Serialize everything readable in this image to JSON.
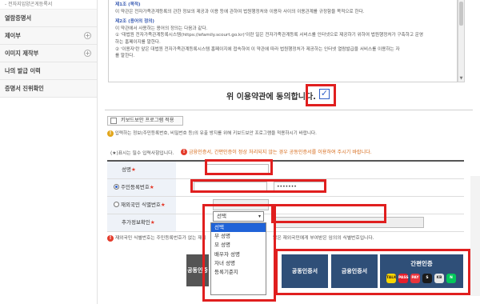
{
  "sidebar": {
    "sub_item": "- 전자지입양곤게등록서",
    "items": [
      {
        "label": "열람증명서",
        "has_plus": false
      },
      {
        "label": "제이부",
        "has_plus": true
      },
      {
        "label": "이미지 제작부",
        "has_plus": true
      },
      {
        "label": "나의 발급 이력",
        "has_plus": false
      },
      {
        "label": "증명서 진위확인",
        "has_plus": false
      }
    ]
  },
  "terms": {
    "lines": [
      {
        "text": "제1조 (목적)",
        "article": true
      },
      {
        "text": "이 약관은 전자가족관계등록의 관한 정보의 제공과 이용 등에 관하여 법원행정처와 이용자 사이의 이용관계를 규정함을 목적으로 한다.",
        "article": false
      },
      {
        "text": "",
        "article": false
      },
      {
        "text": "제2조 (용어의 정의)",
        "article": true
      },
      {
        "text": "이 약관에서 사용하는 용어의 정의는 다음과 같다.",
        "article": false
      },
      {
        "text": "① '대법원 전자가족관계등록시스템(https://efamily.scourt.go.kr)'이란 일은 전자가족관계등록 서비스를 인터넷으로 제공하기 위하여 법원행정처가 구축하고 운영",
        "article": false
      },
      {
        "text": "    하는 홈페이지를 말한다.",
        "article": false
      },
      {
        "text": "② '이용자'란 앞은 대법원 전자가족관계등록시스템 홈페이지에 접속하여 이 약관에 따라 법원행정처가 제공하는 인터넷 열람발급을 서비스를 이용하는 자",
        "article": false
      },
      {
        "text": "    를 말한다.",
        "article": false
      }
    ]
  },
  "agree": {
    "label": "위 이용약관에 동의합니다.",
    "checked": true
  },
  "keyboard": {
    "label": "키보드보안 프로그램 적용",
    "note": "입력하는 정보(주민등록번호, 비밀번호 등)의 유출 방지를 위해 키보드보안 프로그램을 적용하시기 바랍니다."
  },
  "required_note": "(★)표시는 필수 입력사항입니다.",
  "cert_note": "금융인증서, 간편인증이 정상 처리되지 않는 경우 공동인증서를 이용하여 주시기 바랍니다.",
  "form": {
    "name": {
      "label": "성명",
      "value": ""
    },
    "rrn": {
      "label": "주민등록번호",
      "front": "",
      "back": "•••••••"
    },
    "foreign": {
      "label": "재외국민 식별번호",
      "value": ""
    },
    "extra": {
      "label": "추가정보확인",
      "select_value": "선택",
      "select_caret": "▾",
      "input_value": ""
    }
  },
  "dropdown_options": [
    "선택",
    "부 성명",
    "모 성명",
    "배우자 성명",
    "자녀 성명",
    "등록기준지"
  ],
  "id_note": {
    "left": "재외국민 식별번호는 주민등록번호가 없는 재외",
    "right": "않은 재외국민에게 부여받은 임의의 식별번호입니다."
  },
  "buttons": {
    "faded_label": "공동인증",
    "joint_cert": "공동인증서",
    "financial_cert": "금융인증서",
    "simple_cert": "간편인증"
  },
  "brands": [
    {
      "name": "kakao",
      "text": "TALK",
      "bg": "#f7d600",
      "fg": "#3a1d1d"
    },
    {
      "name": "pass",
      "text": "PASS",
      "bg": "#e61e2b",
      "fg": "#ffffff"
    },
    {
      "name": "payco",
      "text": "PAY",
      "bg": "#e8343c",
      "fg": "#ffffff"
    },
    {
      "name": "samsung",
      "text": "S",
      "bg": "#1a1a1a",
      "fg": "#ffffff"
    },
    {
      "name": "kb",
      "text": "KB",
      "bg": "#e6e6e6",
      "fg": "#333333"
    },
    {
      "name": "naver",
      "text": "N",
      "bg": "#03c75a",
      "fg": "#ffffff"
    }
  ]
}
